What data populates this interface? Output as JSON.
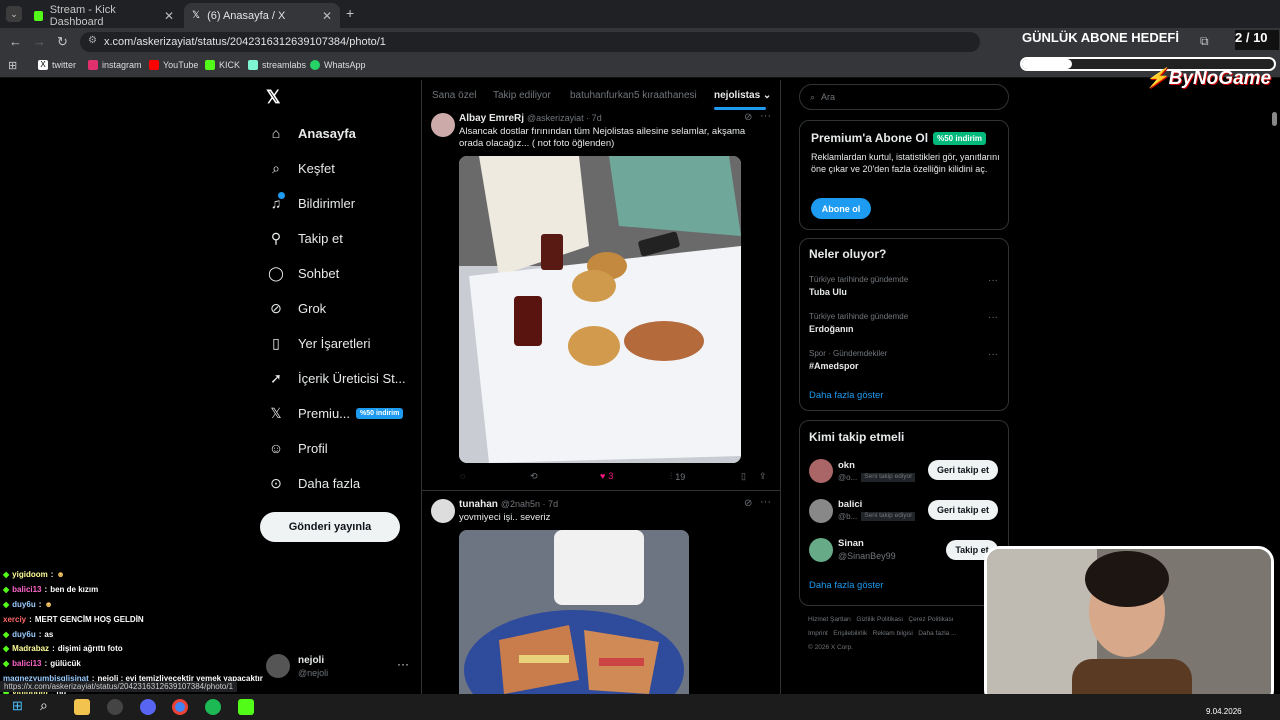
{
  "browser": {
    "tabs": [
      {
        "label": "Stream - Kick Dashboard"
      },
      {
        "label": "(6) Anasayfa / X"
      }
    ],
    "url": "x.com/askerizayiat/status/2042316312639107384/photo/1",
    "bookmarks": [
      "twitter",
      "instagram",
      "YouTube",
      "KICK",
      "streamlabs",
      "WhatsApp"
    ],
    "status_url": "https://x.com/askerizayiat/status/2042316312639107384/photo/1"
  },
  "overlay": {
    "goal_title": "GÜNLÜK ABONE HEDEFİ",
    "goal_count": "2 / 10",
    "goal_progress": 0.2,
    "brand": "ByNoGame"
  },
  "nav": {
    "items": [
      {
        "label": "Anasayfa",
        "icon": "home-icon"
      },
      {
        "label": "Keşfet",
        "icon": "search-icon"
      },
      {
        "label": "Bildirimler",
        "icon": "bell-icon"
      },
      {
        "label": "Takip et",
        "icon": "add-person-icon"
      },
      {
        "label": "Sohbet",
        "icon": "chat-icon"
      },
      {
        "label": "Grok",
        "icon": "grok-icon"
      },
      {
        "label": "Yer İşaretleri",
        "icon": "bookmark-icon"
      },
      {
        "label": "İçerik Üreticisi St...",
        "icon": "rocket-icon"
      },
      {
        "label": "Premiu...",
        "icon": "x-premium-icon",
        "badge": "%50 indirim"
      },
      {
        "label": "Profil",
        "icon": "person-icon"
      },
      {
        "label": "Daha fazla",
        "icon": "more-circle-icon"
      }
    ],
    "post_button": "Gönderi yayınla",
    "account_name": "nejoli",
    "account_handle": "@nejoli"
  },
  "feed": {
    "tabs": [
      "Sana özel",
      "Takip ediliyor",
      "batuhanfurkan5 kıraathanesi",
      "nejolistas"
    ],
    "tweets": [
      {
        "name": "Albay EmreRj",
        "handle": "@askerizayiat · 7d",
        "text": "Alsancak dostlar fırınından tüm Nejolistas ailesine selamlar, akşama orada olacağız... ( not foto öğlenden)",
        "likes": "3",
        "views": "19"
      },
      {
        "name": "tunahan",
        "handle": "@2nah5n · 7d",
        "text": "yovmiyeci işi.. severiz"
      }
    ]
  },
  "right": {
    "search_placeholder": "Ara",
    "premium": {
      "title": "Premium'a Abone Ol",
      "badge": "%50 indirim",
      "text": "Reklamlardan kurtul, istatistikleri gör, yanıtlarını öne çıkar ve 20'den fazla özelliğin kilidini aç.",
      "button": "Abone ol"
    },
    "trends_title": "Neler oluyor?",
    "trends": [
      {
        "context": "Türkiye tarihinde gündemde",
        "name": "Tuba Ulu"
      },
      {
        "context": "Türkiye tarihinde gündemde",
        "name": "Erdoğanın"
      },
      {
        "context": "Spor · Gündemdekiler",
        "name": "#Amedspor"
      }
    ],
    "show_more": "Daha fazla göster",
    "follow_title": "Kimi takip etmeli",
    "follows": [
      {
        "name": "okn",
        "handle": "@o...",
        "tag": "Seni takip ediyor",
        "button": "Geri takip et"
      },
      {
        "name": "balici",
        "handle": "@b...",
        "tag": "Seni takip ediyor",
        "button": "Geri takip et"
      },
      {
        "name": "Sinan",
        "handle": "@SinanBey99",
        "button": "Takip et"
      }
    ],
    "footer": [
      "Hizmet Şartları",
      "Gizlilik Politikası",
      "Çerez Politikası",
      "Imprint",
      "Erişilebilirlik",
      "Reklam bilgisi",
      "Daha fazla ...",
      "© 2026 X Corp."
    ]
  },
  "chat": [
    {
      "user": "yigidoom",
      "msg": ""
    },
    {
      "user": "balici13",
      "msg": "ben de kızım"
    },
    {
      "user": "duy6u",
      "msg": ""
    },
    {
      "user": "xerciy",
      "msg": "MERT GENCİM HOŞ GELDİN"
    },
    {
      "user": "duy6u",
      "msg": "as"
    },
    {
      "user": "Madrabaz",
      "msg": "dişimi ağrıttı foto"
    },
    {
      "user": "balici13",
      "msg": "gülücük"
    },
    {
      "user": "magnezyumbisglisinat",
      "msg": "nejoli : evi temizliyecektir yemek yapacaktır"
    },
    {
      "user": "yigidoom",
      "msg": "hg"
    }
  ],
  "taskbar": {
    "date": "9.04.2026"
  },
  "colors": {
    "accent": "#1d9bf0",
    "premium_green": "#00ba7c",
    "kick": "#53fc18"
  }
}
